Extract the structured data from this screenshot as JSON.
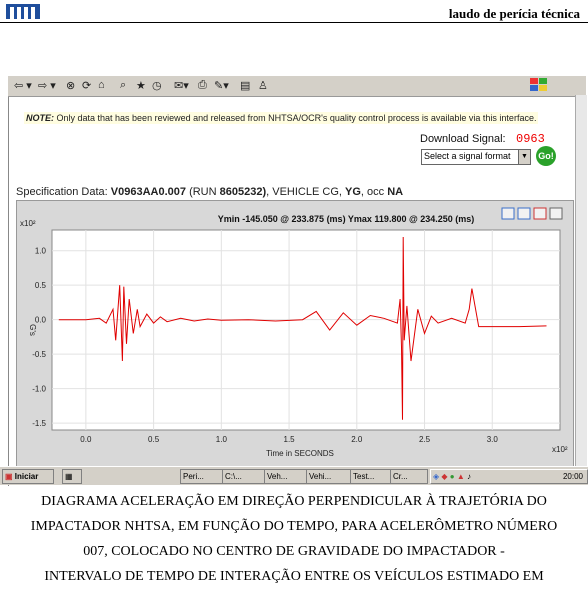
{
  "header": {
    "title": "laudo de perícia técnica",
    "logo": "logo-icon"
  },
  "toolbar": {
    "icons": [
      "back-icon",
      "forward-icon",
      "stop-icon",
      "refresh-icon",
      "home-icon",
      "search-icon",
      "favorites-icon",
      "history-icon",
      "mail-icon",
      "print-icon",
      "edit-icon",
      "discuss-icon",
      "messenger-icon"
    ]
  },
  "note": {
    "label": "NOTE:",
    "text": " Only data that has been reviewed and released from NHTSA/OCR's quality control process is available via this interface."
  },
  "download": {
    "label": "Download Signal:",
    "number": "0963",
    "select_value": "Select a signal format",
    "go_label": "Go!"
  },
  "spec": {
    "prefix": "Specification Data:",
    "id": "V0963AA0.007",
    "run_open": "(RUN",
    "run": "8605232)",
    "vehicle": ", VEHICLE CG, ",
    "axis": "YG",
    "occ": ", occ ",
    "occ_val": "NA"
  },
  "chart_data": {
    "type": "line",
    "title": "Ymin -145.050 @ 233.875 (ms)  Ymax 119.800 @ 234.250 (ms)",
    "xlabel": "Time in SECONDS",
    "ylabel": "G's",
    "x_multiplier": "x10²",
    "y_multiplier": "x10²",
    "xlim": [
      -0.25,
      3.5
    ],
    "ylim": [
      -1.6,
      1.3
    ],
    "x_ticks": [
      0.0,
      0.5,
      1.0,
      1.5,
      2.0,
      2.5,
      3.0
    ],
    "y_ticks": [
      1.0,
      0.5,
      0.0,
      -0.5,
      -1.0,
      -1.5
    ],
    "x_tick_labels": [
      "0.0",
      "0.5",
      "1.0",
      "1.5",
      "2.0",
      "2.5",
      "3.0"
    ],
    "y_tick_labels": [
      "1.0",
      "0.5",
      "0.0",
      "-0.5",
      "-1.0",
      "-1.5"
    ],
    "series": [
      {
        "color": "#e00000",
        "x": [
          -0.2,
          0.0,
          0.1,
          0.15,
          0.2,
          0.22,
          0.25,
          0.27,
          0.28,
          0.3,
          0.32,
          0.35,
          0.38,
          0.4,
          0.45,
          0.5,
          0.55,
          0.6,
          0.7,
          0.8,
          0.9,
          1.0,
          1.2,
          1.4,
          1.6,
          1.7,
          1.8,
          1.9,
          2.0,
          2.1,
          2.2,
          2.3,
          2.32,
          2.33,
          2.3375,
          2.3425,
          2.35,
          2.37,
          2.4,
          2.45,
          2.5,
          2.55,
          2.6,
          2.7,
          2.8,
          2.83,
          2.85,
          2.9,
          3.0,
          3.2,
          3.4
        ],
        "y": [
          0.0,
          0.0,
          0.02,
          -0.05,
          0.15,
          -0.3,
          0.5,
          -0.6,
          0.48,
          -0.35,
          0.3,
          -0.2,
          0.15,
          -0.1,
          0.08,
          -0.05,
          0.04,
          -0.03,
          0.02,
          -0.02,
          0.01,
          -0.01,
          0.0,
          -0.02,
          0.0,
          0.12,
          -0.15,
          0.1,
          -0.08,
          0.06,
          0.02,
          -0.05,
          0.3,
          -0.4,
          -1.4505,
          1.198,
          -0.3,
          0.2,
          -0.6,
          0.15,
          -0.2,
          0.05,
          -0.05,
          0.02,
          -0.05,
          0.15,
          0.45,
          -0.1,
          -0.1,
          -0.1,
          -0.09
        ]
      }
    ]
  },
  "chart_buttons": [
    "save-chart-icon",
    "export-chart-icon",
    "zoom-chart-icon",
    "close-chart-icon"
  ],
  "taskbar": {
    "start": "Iniciar",
    "tasks": [
      "Peri...",
      "C:\\...",
      "Veh...",
      "Vehi...",
      "Test...",
      "Cr..."
    ],
    "clock": "20:00"
  },
  "caption": [
    "DIAGRAMA ACELERAÇÃO EM DIREÇÃO PERPENDICULAR À TRAJETÓRIA DO",
    "IMPACTADOR NHTSA, EM FUNÇÃO DO TEMPO, PARA ACELERÔMETRO NÚMERO",
    "007, COLOCADO NO CENTRO DE GRAVIDADE DO IMPACTADOR -",
    "INTERVALO DE TEMPO DE INTERAÇÃO ENTRE OS VEÍCULOS ESTIMADO EM"
  ]
}
